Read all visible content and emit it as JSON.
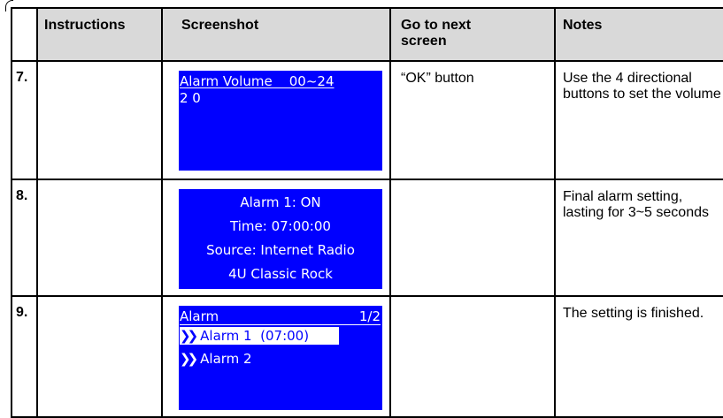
{
  "table": {
    "headers": [
      "Instructions",
      "Screenshot",
      "Go to next screen",
      "Notes"
    ],
    "header_bg": "#d9d9d9",
    "rows": [
      {
        "num": "7.",
        "instructions": "",
        "screenshot": {
          "lines": [
            "Alarm Volume    00~24",
            "2 0"
          ]
        },
        "next": "“OK” button",
        "notes": "Use the 4 directional buttons to set the volume"
      },
      {
        "num": "8.",
        "instructions": "",
        "screenshot": {
          "lines": [
            "Alarm 1: ON",
            "Time: 07:00:00",
            "Source: Internet Radio",
            "4U Classic Rock"
          ]
        },
        "next": "",
        "notes": "Final alarm setting, lasting for 3~5 seconds"
      },
      {
        "num": "9.",
        "instructions": "",
        "screenshot": {
          "title": "Alarm",
          "page": "1/2",
          "items": [
            "Alarm 1  (07:00)",
            "Alarm 2"
          ],
          "selected_index": 0,
          "chevron_icon": "double-chevron-right-icon"
        },
        "next": "",
        "notes": "The setting is finished."
      }
    ]
  },
  "colors": {
    "screen_bg": "#0000ff",
    "screen_fg": "#ffffff",
    "border": "#000000"
  }
}
